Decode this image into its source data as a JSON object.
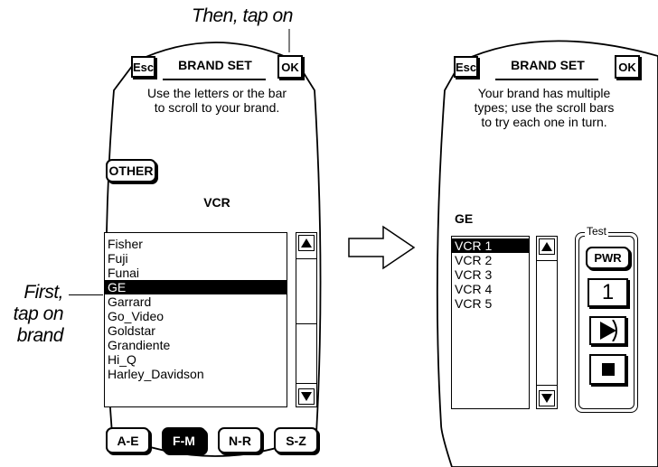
{
  "annotations": {
    "then_tap": "Then, tap on",
    "first_tap": [
      "First,",
      "tap on",
      "brand"
    ]
  },
  "screen1": {
    "esc_label": "Esc",
    "title": "BRAND SET",
    "ok_label": "OK",
    "instructions": [
      "Use the letters or the bar",
      "to scroll to your brand."
    ],
    "other_label": "OTHER",
    "device_label": "VCR",
    "brands": [
      "Fisher",
      "Fuji",
      "Funai",
      "GE",
      "Garrard",
      "Go_Video",
      "Goldstar",
      "Grandiente",
      "Hi_Q",
      "Harley_Davidson"
    ],
    "selected_brand": "GE",
    "letter_tabs": [
      "A-E",
      "F-M",
      "N-R",
      "S-Z"
    ],
    "selected_tab": "F-M"
  },
  "screen2": {
    "esc_label": "Esc",
    "title": "BRAND SET",
    "ok_label": "OK",
    "instructions": [
      "Your brand has multiple",
      "types; use the scroll bars",
      "to try each one in turn."
    ],
    "brand_label": "GE",
    "types": [
      "VCR 1",
      "VCR 2",
      "VCR 3",
      "VCR 4",
      "VCR 5"
    ],
    "selected_type": "VCR 1",
    "test_label": "Test",
    "pwr_label": "PWR",
    "digit_label": "1"
  }
}
